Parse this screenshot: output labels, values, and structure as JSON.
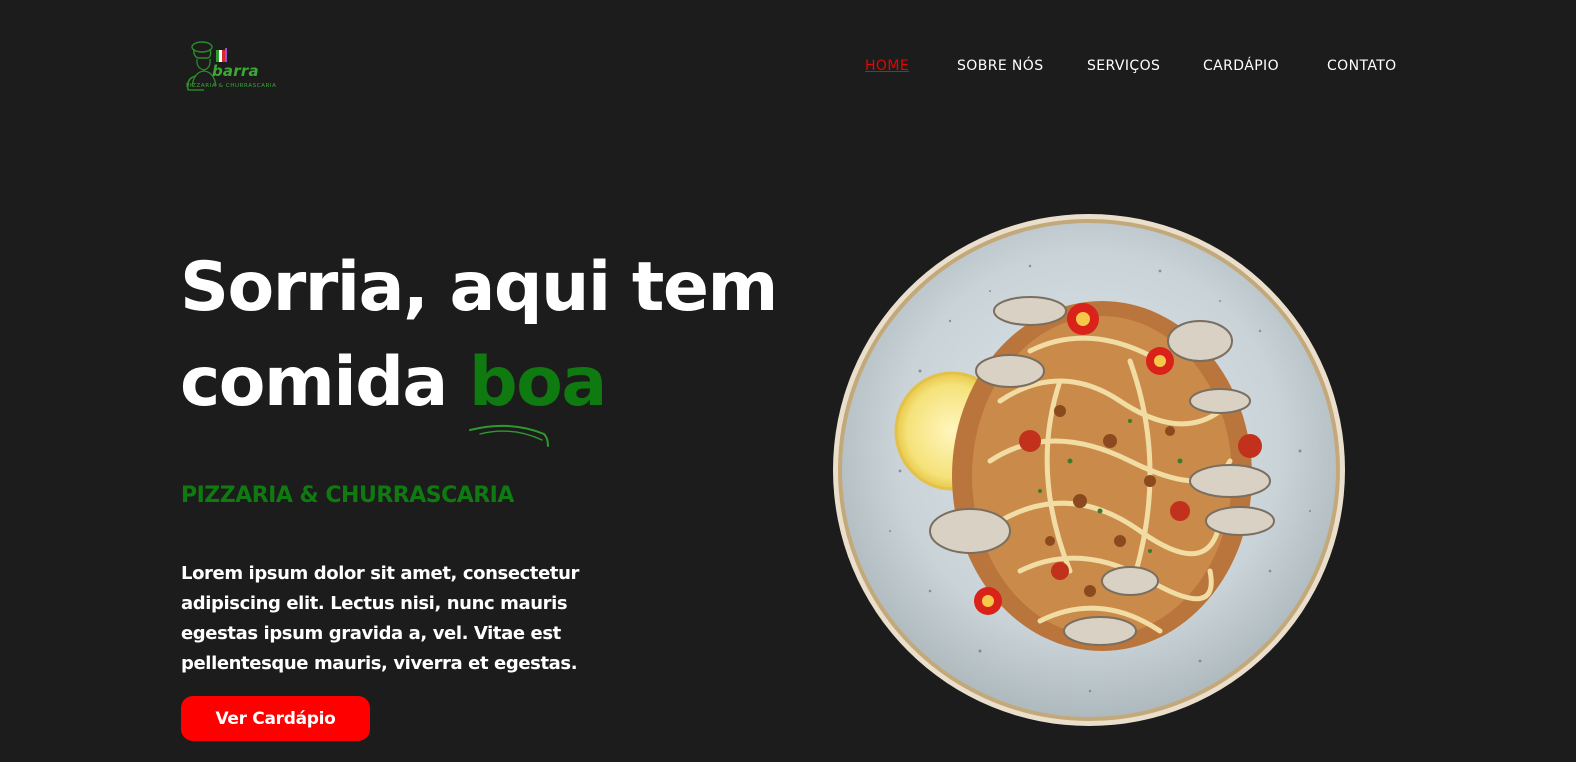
{
  "brand": {
    "logo_word": "barra",
    "logo_sub": "PIZZARIA & CHURRASCARIA"
  },
  "nav": {
    "items": [
      {
        "label": "HOME",
        "active": true
      },
      {
        "label": "SOBRE NÓS",
        "active": false
      },
      {
        "label": "SERVIÇOS",
        "active": false
      },
      {
        "label": "CARDÁPIO",
        "active": false
      },
      {
        "label": "CONTATO",
        "active": false
      }
    ]
  },
  "hero": {
    "title_line1": "Sorria, aqui tem",
    "title_line2_prefix": "comida",
    "title_accent": "boa",
    "subtitle": "PIZZARIA & CHURRASCARIA",
    "description": "Lorem ipsum dolor sit amet, consectetur adipiscing elit. Lectus nisi, nunc mauris egestas ipsum gravida a, vel. Vitae est pellentesque mauris, viverra et egestas.",
    "cta_label": "Ver Cardápio"
  },
  "colors": {
    "background": "#1c1c1c",
    "accent_green": "#0f7a0f",
    "nav_active": "#e10600",
    "cta": "#ff0000",
    "text": "#ffffff"
  },
  "dish_image": {
    "icon": "pasta-plate-photo"
  }
}
